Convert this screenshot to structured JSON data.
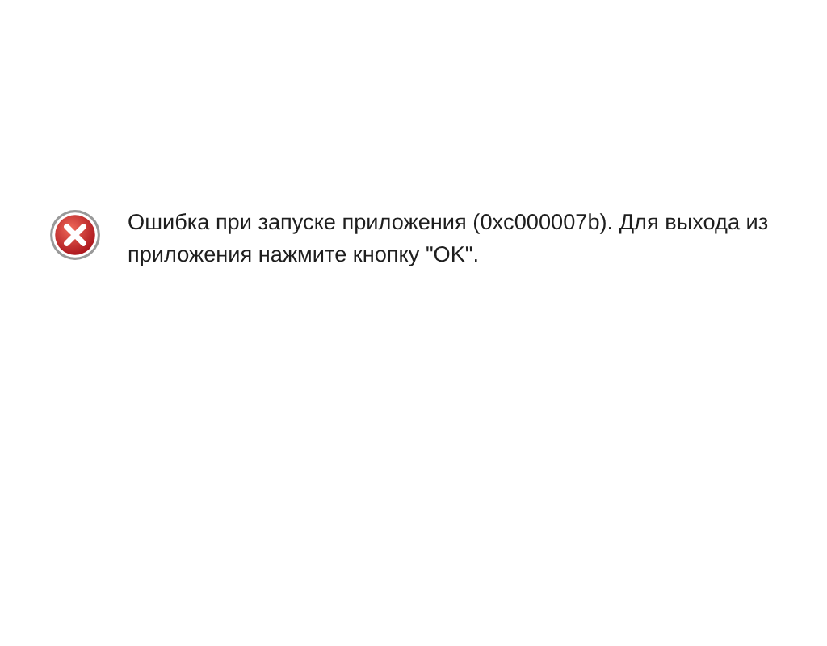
{
  "dialog": {
    "kind": "error",
    "message": "Ошибка при запуске приложения (0xc000007b). Для выхода из приложения нажмите кнопку \"OK\"."
  }
}
